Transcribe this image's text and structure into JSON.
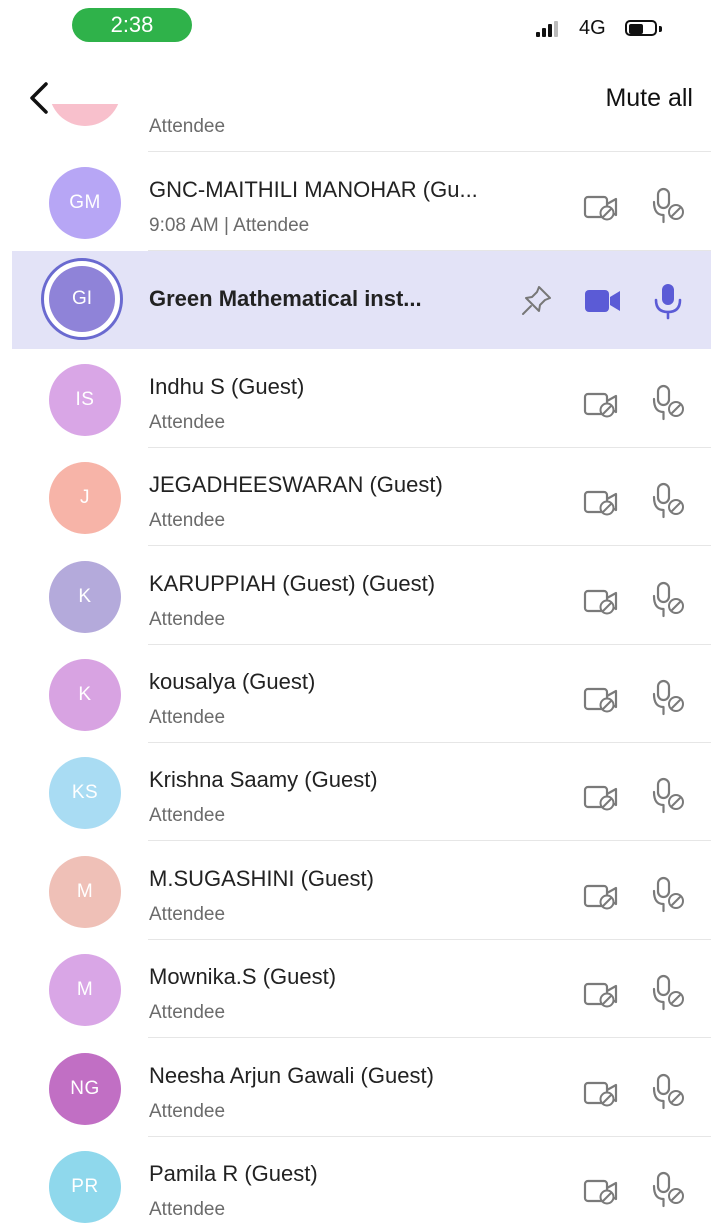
{
  "status_bar": {
    "time": "2:38",
    "network": "4G"
  },
  "header": {
    "mute_all_label": "Mute all"
  },
  "partial_row": {
    "subtitle": "Attendee"
  },
  "colors": {
    "highlight": "#e3e3f7",
    "accent": "#5b5bd6",
    "pill": "#2fb24a"
  },
  "participants": [
    {
      "initials": "GM",
      "name": "GNC-MAITHILI MANOHAR (Gu...",
      "subtitle": "9:08 AM | Attendee",
      "avatar_color": "#b7a6f5",
      "highlighted": false,
      "camera": "off",
      "mic": "off"
    },
    {
      "initials": "GI",
      "name": "Green Mathematical inst...",
      "subtitle": "",
      "avatar_color": "#8f83d8",
      "highlighted": true,
      "camera": "on",
      "mic": "on",
      "pinnable": true
    },
    {
      "initials": "IS",
      "name": "Indhu S (Guest)",
      "subtitle": "Attendee",
      "avatar_color": "#d9a6e6",
      "highlighted": false,
      "camera": "off",
      "mic": "off"
    },
    {
      "initials": "J",
      "name": "JEGADHEESWARAN (Guest)",
      "subtitle": "Attendee",
      "avatar_color": "#f7b4a8",
      "highlighted": false,
      "camera": "off",
      "mic": "off"
    },
    {
      "initials": "K",
      "name": "KARUPPIAH (Guest) (Guest)",
      "subtitle": "Attendee",
      "avatar_color": "#b4aadb",
      "highlighted": false,
      "camera": "off",
      "mic": "off"
    },
    {
      "initials": "K",
      "name": "kousalya (Guest)",
      "subtitle": "Attendee",
      "avatar_color": "#d8a3e2",
      "highlighted": false,
      "camera": "off",
      "mic": "off"
    },
    {
      "initials": "KS",
      "name": "Krishna Saamy (Guest)",
      "subtitle": "Attendee",
      "avatar_color": "#a9dcf3",
      "highlighted": false,
      "camera": "off",
      "mic": "off"
    },
    {
      "initials": "M",
      "name": "M.SUGASHINI (Guest)",
      "subtitle": "Attendee",
      "avatar_color": "#efc0b7",
      "highlighted": false,
      "camera": "off",
      "mic": "off"
    },
    {
      "initials": "M",
      "name": "Mownika.S (Guest)",
      "subtitle": "Attendee",
      "avatar_color": "#d9a6e6",
      "highlighted": false,
      "camera": "off",
      "mic": "off"
    },
    {
      "initials": "NG",
      "name": "Neesha Arjun Gawali  (Guest)",
      "subtitle": "Attendee",
      "avatar_color": "#c16fc4",
      "highlighted": false,
      "camera": "off",
      "mic": "off"
    },
    {
      "initials": "PR",
      "name": "Pamila R (Guest)",
      "subtitle": "Attendee",
      "avatar_color": "#8fd8ec",
      "highlighted": false,
      "camera": "off",
      "mic": "off"
    }
  ]
}
